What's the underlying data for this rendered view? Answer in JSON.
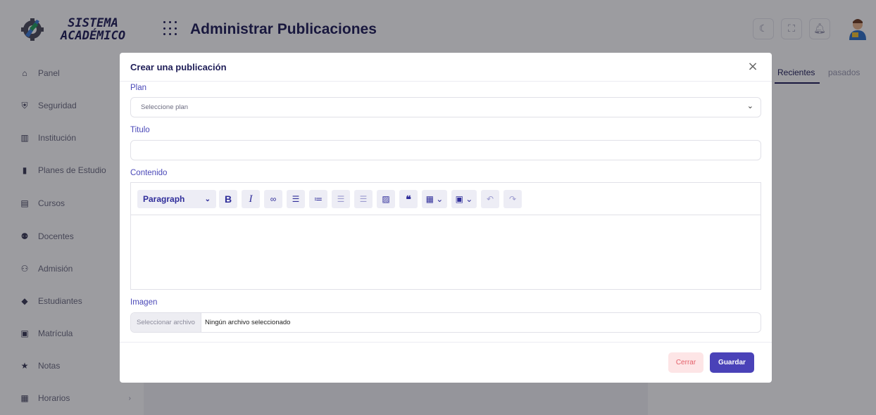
{
  "brand": {
    "line1": "SISTEMA",
    "line2": "ACADÉMICO"
  },
  "header": {
    "title": "Administrar Publicaciones",
    "buttons": [
      "moon-icon",
      "fullscreen-icon",
      "bell-icon"
    ]
  },
  "sidebar": {
    "items": [
      {
        "label": "Panel",
        "icon": "home-icon"
      },
      {
        "label": "Seguridad",
        "icon": "shield-icon"
      },
      {
        "label": "Institución",
        "icon": "building-icon"
      },
      {
        "label": "Planes de Estudio",
        "icon": "map-icon"
      },
      {
        "label": "Cursos",
        "icon": "book-icon"
      },
      {
        "label": "Docentes",
        "icon": "users-icon"
      },
      {
        "label": "Admisión",
        "icon": "user-plus-icon"
      },
      {
        "label": "Estudiantes",
        "icon": "graduation-cap-icon"
      },
      {
        "label": "Matrícula",
        "icon": "register-icon"
      },
      {
        "label": "Notas",
        "icon": "star-icon"
      },
      {
        "label": "Horarios",
        "icon": "calendar-icon"
      }
    ]
  },
  "right_panel": {
    "tabs": [
      "Recientes",
      "pasados"
    ],
    "active_tab": "Recientes"
  },
  "modal": {
    "title": "Crear una publicación",
    "plan": {
      "label": "Plan",
      "placeholder": "Seleccione plan"
    },
    "titulo": {
      "label": "Titulo",
      "value": ""
    },
    "contenido": {
      "label": "Contenido",
      "format": "Paragraph",
      "body": ""
    },
    "toolbar": [
      "bold",
      "italic",
      "link",
      "bulleted-list",
      "numbered-list",
      "outdent",
      "indent",
      "image",
      "blockquote",
      "table",
      "media",
      "undo",
      "redo"
    ],
    "imagen": {
      "label": "Imagen",
      "button": "Seleccionar archivo",
      "status": "Ningún archivo seleccionado"
    },
    "buttons": {
      "close": "Cerrar",
      "save": "Guardar"
    }
  },
  "colors": {
    "primary": "#4a42b8",
    "navy": "#1e1d57",
    "danger_soft": "#fde5e6",
    "danger": "#e4606a"
  }
}
